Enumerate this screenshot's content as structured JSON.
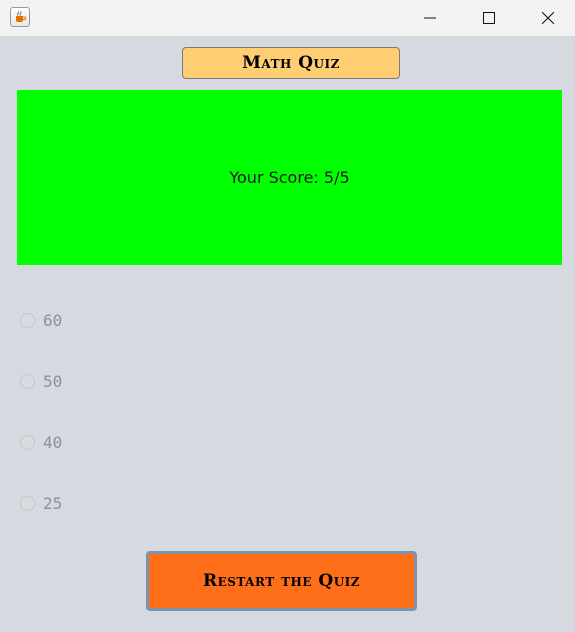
{
  "window": {
    "icon": "java-coffee-icon",
    "controls": {
      "minimize_icon": "minimize-icon",
      "maximize_icon": "maximize-icon",
      "close_icon": "close-icon"
    }
  },
  "quiz": {
    "title": "Math Quiz",
    "score_text": "Your Score: 5/5",
    "options": [
      "60",
      "50",
      "40",
      "25"
    ],
    "restart_label": "Restart the Quiz"
  },
  "colors": {
    "background": "#d6d9e0",
    "title_button": "#ffce73",
    "score_panel": "#00ff00",
    "restart_button": "#ff6f1a"
  }
}
